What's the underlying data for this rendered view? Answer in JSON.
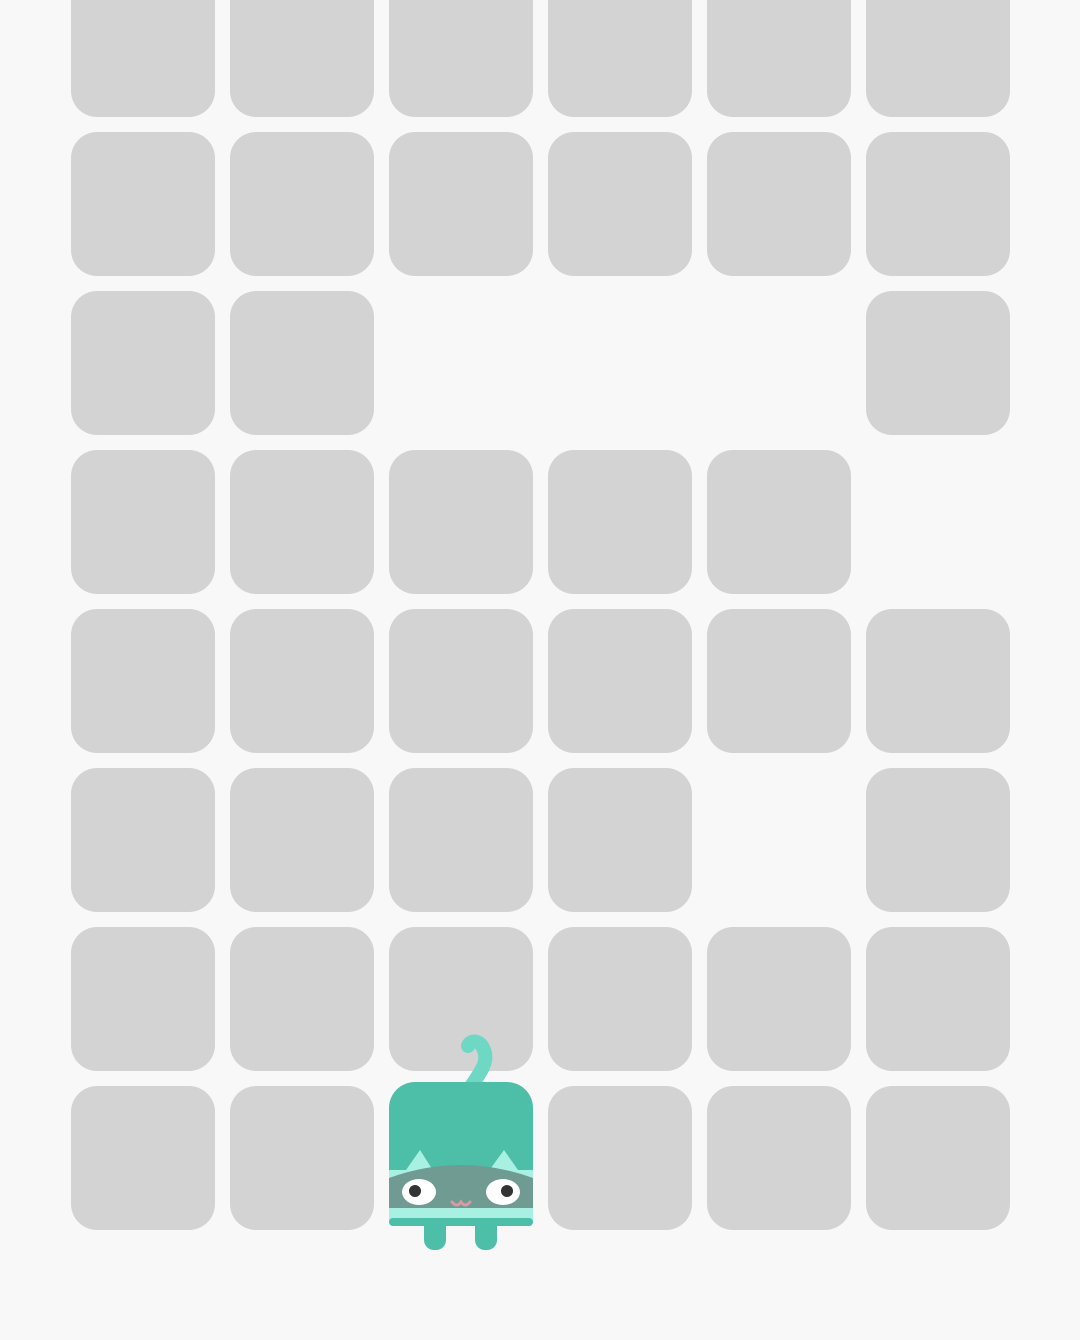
{
  "game": {
    "colors": {
      "background": "#f8f8f8",
      "tile": "#d3d3d3",
      "player_body": "#4dbea8",
      "player_light": "#a8f0e2",
      "player_mask": "#6f9b92",
      "player_tail": "#6fd8c4"
    },
    "grid": {
      "rows": 8,
      "cols": 6,
      "cells": [
        [
          1,
          1,
          1,
          1,
          1,
          1
        ],
        [
          1,
          1,
          1,
          1,
          1,
          1
        ],
        [
          1,
          1,
          0,
          0,
          0,
          1
        ],
        [
          1,
          1,
          1,
          1,
          1,
          0
        ],
        [
          1,
          1,
          1,
          1,
          1,
          1
        ],
        [
          1,
          1,
          1,
          1,
          0,
          1
        ],
        [
          1,
          1,
          1,
          1,
          1,
          1
        ],
        [
          1,
          1,
          0,
          1,
          1,
          1
        ]
      ]
    },
    "player": {
      "icon": "cat-block-character",
      "row": 7,
      "col": 2
    }
  }
}
